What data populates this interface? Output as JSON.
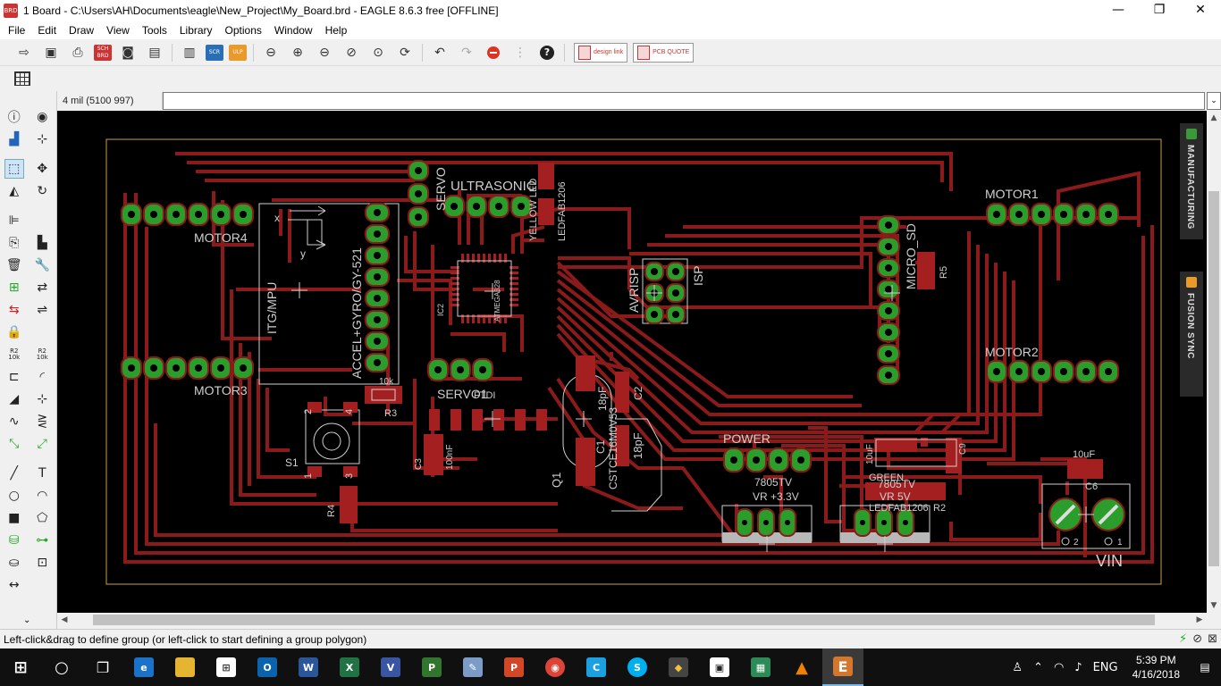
{
  "window": {
    "title": "1 Board - C:\\Users\\AH\\Documents\\eagle\\New_Project\\My_Board.brd - EAGLE 8.6.3 free [OFFLINE]",
    "minimize": "—",
    "maximize": "❐",
    "close": "✕"
  },
  "menu": [
    "File",
    "Edit",
    "Draw",
    "View",
    "Tools",
    "Library",
    "Options",
    "Window",
    "Help"
  ],
  "toolbar": {
    "sch_brd": "SCH BRD",
    "scr": "SCR",
    "ulp": "ULP",
    "design_link": "design link",
    "pcb_quote": "PCB QUOTE"
  },
  "cmdbar": {
    "coordinate": "4 mil (5100 997)",
    "command_value": ""
  },
  "panels": {
    "manufacturing": "MANUFACTURING",
    "fusion_sync": "FUSION SYNC"
  },
  "board": {
    "labels": {
      "motor1": "MOTOR1",
      "motor2": "MOTOR2",
      "motor3": "MOTOR3",
      "motor4": "MOTOR4",
      "servo": "SERVO",
      "servo1": "SERVO1",
      "ultrasonic": "ULTRASONIC",
      "yellow_led": "YELLOW LED",
      "ledfab1206": "LEDFAB1206",
      "mcu_name": "ATMEGA328",
      "ic2": "IC2",
      "avrisp": "AVRISP",
      "isp": "ISP",
      "micro_sd": "MICRO_SD",
      "r5": "R5",
      "itg_mpu": "ITG/MPU",
      "accel_gyro": "ACCEL+GYRO/GY-521",
      "axis_x": "x",
      "axis_y": "y",
      "r3_value": "10k",
      "r3": "R3",
      "s1": "S1",
      "r4": "R4",
      "c3": "C3",
      "c3_value": "100nF",
      "ftdi": "FTDI",
      "q1": "Q1",
      "crystal": "CSTCE16M0V53",
      "c1": "C1",
      "c2": "C2",
      "c2_value": "18pF",
      "c1_value": "18pF",
      "power": "POWER",
      "reg33_name": "7805TV",
      "reg33": "VR +3.3V",
      "reg5_name": "7805TV",
      "reg5": "VR 5V",
      "green_led": "GREEN",
      "led2": "LEDFAB1206",
      "r2": "R2",
      "c9": "C9",
      "c6_value": "10uF",
      "c6": "C6",
      "vin": "VIN",
      "pin1": "1",
      "pin2": "2",
      "pin3": "3",
      "pin4": "4",
      "pin_1": "1",
      "pin_2": "2",
      "cap_10uf": "10uF"
    }
  },
  "status": {
    "message": "Left-click&drag to define group (or left-click to start defining a group polygon)"
  },
  "taskbar": {
    "lang": "ENG",
    "time": "5:39 PM",
    "date": "4/16/2018"
  },
  "colors": {
    "trace": "#8b1a1a",
    "pad": "#2a9d2a",
    "board_outline": "#c8a040",
    "silk": "#cfcfcf"
  }
}
